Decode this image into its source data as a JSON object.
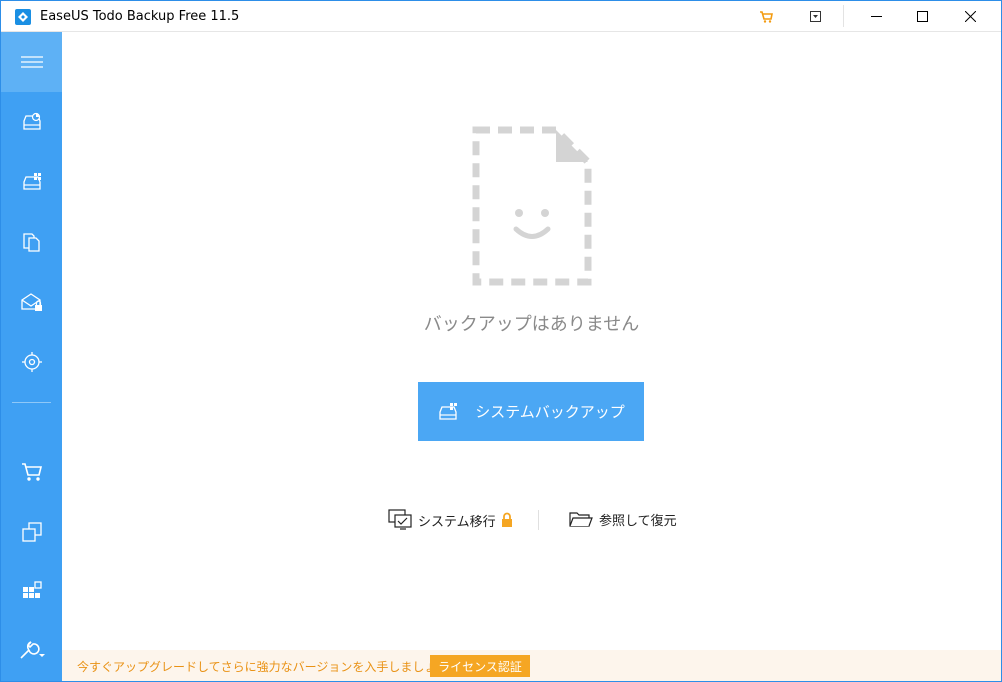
{
  "window": {
    "title": "EaseUS Todo Backup Free 11.5",
    "accent_color": "#3fa0f3",
    "title_buttons": [
      "cart-icon",
      "menu-dropdown-icon",
      "minimize-icon",
      "maximize-icon",
      "close-icon"
    ]
  },
  "sidebar": {
    "items": [
      {
        "icon": "hamburger-menu-icon"
      },
      {
        "icon": "disk-backup-icon"
      },
      {
        "icon": "system-backup-icon"
      },
      {
        "icon": "file-backup-icon"
      },
      {
        "icon": "mail-backup-icon"
      },
      {
        "icon": "smart-backup-icon"
      },
      {
        "icon": "cart-icon"
      },
      {
        "icon": "clone-icon"
      },
      {
        "icon": "tools-grid-icon"
      },
      {
        "icon": "wrench-settings-icon"
      }
    ]
  },
  "main": {
    "empty_message": "バックアップはありません",
    "primary_button": "システムバックアップ",
    "links": {
      "migrate": "システム移行",
      "browse": "参照して復元"
    }
  },
  "footer": {
    "promo_text": "今すぐアップグレードしてさらに強力なバージョンを入手しましょう。",
    "license_button": "ライセンス認証",
    "promo_color": "#e99215"
  }
}
